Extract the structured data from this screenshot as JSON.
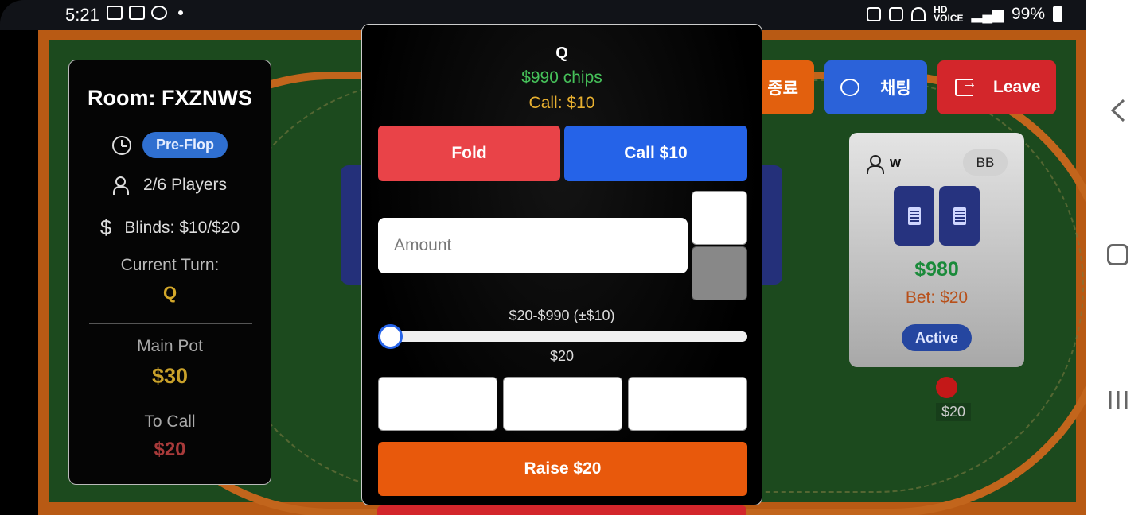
{
  "status_bar": {
    "time": "5:21",
    "battery": "99%"
  },
  "info_panel": {
    "room": "Room: FXZNWS",
    "stage": "Pre-Flop",
    "players": "2/6 Players",
    "blinds": "Blinds: $10/$20",
    "turn_label": "Current Turn:",
    "turn_name": "Q",
    "pot_label": "Main Pot",
    "pot_value": "$30",
    "to_call_label": "To Call",
    "to_call_value": "$20"
  },
  "top_buttons": {
    "end_label": "종료",
    "chat_label": "채팅",
    "leave_label": "Leave"
  },
  "player_card": {
    "name": "w",
    "role_badge": "BB",
    "stack": "$980",
    "bet": "Bet: $20",
    "status": "Active",
    "chip_amount": "$20"
  },
  "action_modal": {
    "player_name": "Q",
    "chips": "$990 chips",
    "call_info": "Call: $10",
    "fold_label": "Fold",
    "call_label": "Call $10",
    "amount_placeholder": "Amount",
    "range_label": "$20-$990 (±$10)",
    "slider_value": "$20",
    "raise_label": "Raise $20"
  },
  "colors": {
    "fold": "#e94348",
    "call": "#2563e8",
    "raise": "#e8590c",
    "leave": "#d3262b",
    "felt": "#1c4a1e"
  }
}
